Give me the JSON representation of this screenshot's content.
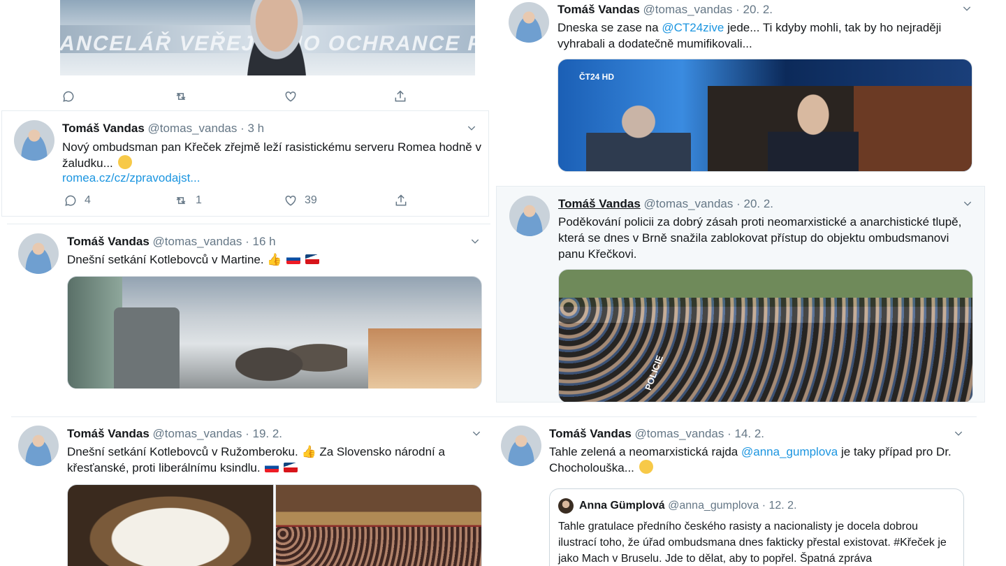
{
  "author": {
    "name": "Tomáš Vandas",
    "handle": "@tomas_vandas"
  },
  "top_image_text": "KANCELÁŘ VEŘEJNÉHO OCHRANCE PRÁV",
  "tweets": [
    {
      "time": "3 h",
      "text": "Nový ombudsman pan Křeček zřejmě leží rasistickému serveru Romea hodně v žaludku...",
      "link": "romea.cz/cz/zpravodajst...",
      "replies": "4",
      "retweets": "1",
      "likes": "39"
    },
    {
      "time": "16 h",
      "text": "Dnešní setkání Kotlebovců v Martine."
    },
    {
      "time": "19. 2.",
      "text_a": "Dnešní setkání Kotlebovců v Ružomberoku.",
      "text_b": "Za Slovensko národní a křesťanské, proti liberálnímu ksindlu."
    },
    {
      "time": "20. 2.",
      "text_a": "Dneska se zase na",
      "mention": "@CT24zive",
      "text_b": "jede... Ti kdyby mohli, tak by ho nejraději vyhrabali a dodatečně mumifikovali...",
      "media_logo": "ČT24 HD"
    },
    {
      "time": "20. 2.",
      "text": "Poděkování policii za dobrý zásah proti neomarxistické a anarchistické tlupě, která se dnes v Brně snažila zablokovat přístup do objektu ombudsmanovi panu Křečkovi.",
      "media_text": "POLICIE"
    },
    {
      "time": "14. 2.",
      "text_a": "Tahle zelená a neomarxistická rajda",
      "mention": "@anna_gumplova",
      "text_b": "je taky případ pro Dr. Chocholouška...",
      "quote": {
        "name": "Anna Gümplová",
        "handle": "@anna_gumplova",
        "time": "12. 2.",
        "text": "Tahle gratulace předního českého rasisty a nacionalisty je docela dobrou ilustrací toho, že úřad ombudsmana dnes fakticky přestal existovat. #Křeček je jako Mach v Bruselu. Jde to dělat, aby to popřel. Špatná zpráva"
      }
    }
  ],
  "dot": "·",
  "colors": {
    "link": "#1b95e0",
    "muted": "#657786",
    "text": "#14171a"
  }
}
